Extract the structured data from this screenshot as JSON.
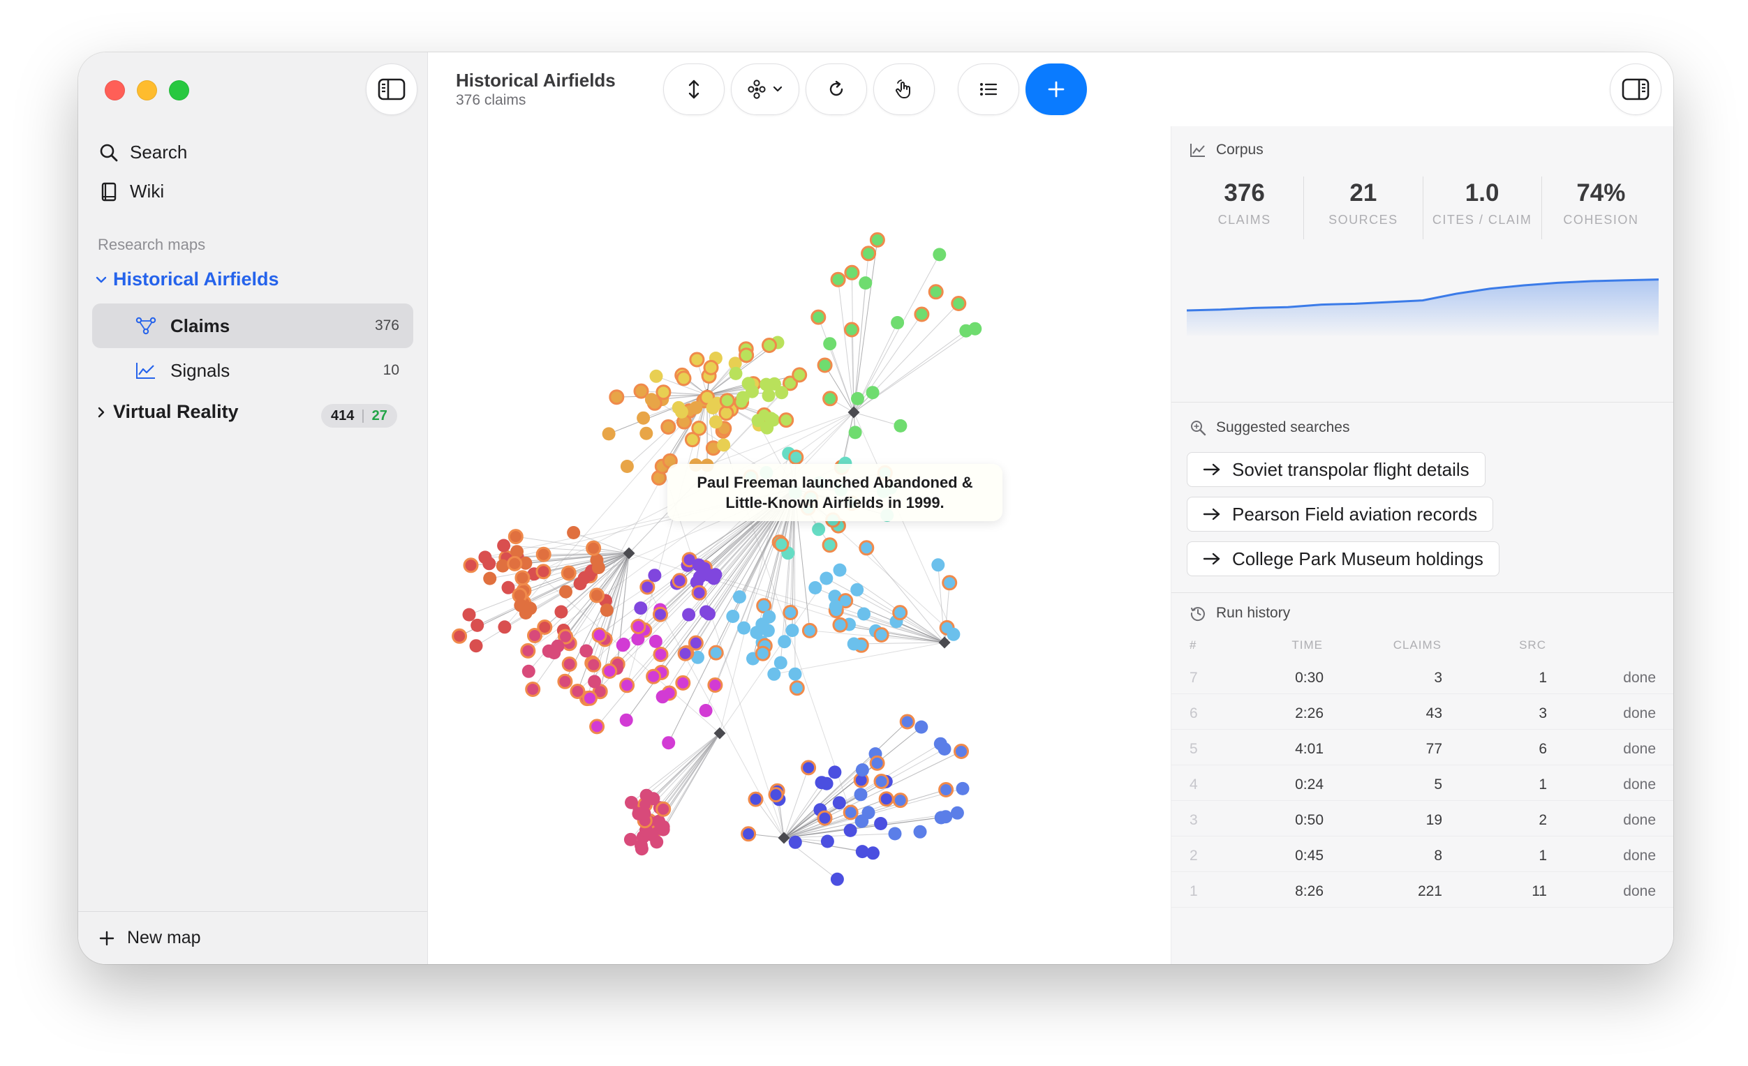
{
  "sidebar": {
    "nav": [
      {
        "label": "Search",
        "icon": "magnifier-icon"
      },
      {
        "label": "Wiki",
        "icon": "book-icon"
      }
    ],
    "section_label": "Research maps",
    "maps": [
      {
        "name": "Historical Airfields",
        "expanded": true,
        "children": [
          {
            "label": "Claims",
            "count": "376",
            "icon": "graph-nodes-icon",
            "selected": true
          },
          {
            "label": "Signals",
            "count": "10",
            "icon": "line-chart-icon"
          }
        ]
      },
      {
        "name": "Virtual Reality",
        "expanded": false,
        "badge_a": "414",
        "badge_sep": "|",
        "badge_b": "27"
      }
    ],
    "footer": {
      "new_map_label": "New map"
    }
  },
  "header": {
    "title": "Historical Airfields",
    "subtitle": "376 claims"
  },
  "graph": {
    "tooltip": "Paul Freeman launched Abandoned & Little-Known Airfields in 1999.",
    "palette": [
      "#d94f4f",
      "#e0703f",
      "#e8a547",
      "#e8cf52",
      "#b9e15b",
      "#6fdc6f",
      "#66dcc4",
      "#6bc0ec",
      "#5b7ee8",
      "#4b4fe0",
      "#8046de",
      "#d23bd4",
      "#d84a7a"
    ],
    "highlight_color": "#f08a4b",
    "edge_color": "#a9a9ad"
  },
  "panel": {
    "corpus_label": "Corpus",
    "stats": [
      {
        "value": "376",
        "label": "CLAIMS"
      },
      {
        "value": "21",
        "label": "SOURCES"
      },
      {
        "value": "1.0",
        "label": "CITES / CLAIM"
      },
      {
        "value": "74%",
        "label": "COHESION"
      }
    ],
    "sparkline": [
      0.3,
      0.31,
      0.33,
      0.34,
      0.37,
      0.38,
      0.4,
      0.42,
      0.5,
      0.56,
      0.6,
      0.63,
      0.65,
      0.66,
      0.67
    ],
    "sparkline_color": "#3b7be8",
    "suggested_label": "Suggested searches",
    "suggested": [
      "Soviet transpolar flight details",
      "Pearson Field aviation records",
      "College Park Museum holdings"
    ],
    "run_history_label": "Run history",
    "run_history_columns": [
      "#",
      "TIME",
      "CLAIMS",
      "SRC"
    ],
    "runs": [
      {
        "n": "7",
        "time": "0:30",
        "claims": "3",
        "src": "1",
        "status": "done"
      },
      {
        "n": "6",
        "time": "2:26",
        "claims": "43",
        "src": "3",
        "status": "done"
      },
      {
        "n": "5",
        "time": "4:01",
        "claims": "77",
        "src": "6",
        "status": "done"
      },
      {
        "n": "4",
        "time": "0:24",
        "claims": "5",
        "src": "1",
        "status": "done"
      },
      {
        "n": "3",
        "time": "0:50",
        "claims": "19",
        "src": "2",
        "status": "done"
      },
      {
        "n": "2",
        "time": "0:45",
        "claims": "8",
        "src": "1",
        "status": "done"
      },
      {
        "n": "1",
        "time": "8:26",
        "claims": "221",
        "src": "11",
        "status": "done"
      }
    ]
  }
}
